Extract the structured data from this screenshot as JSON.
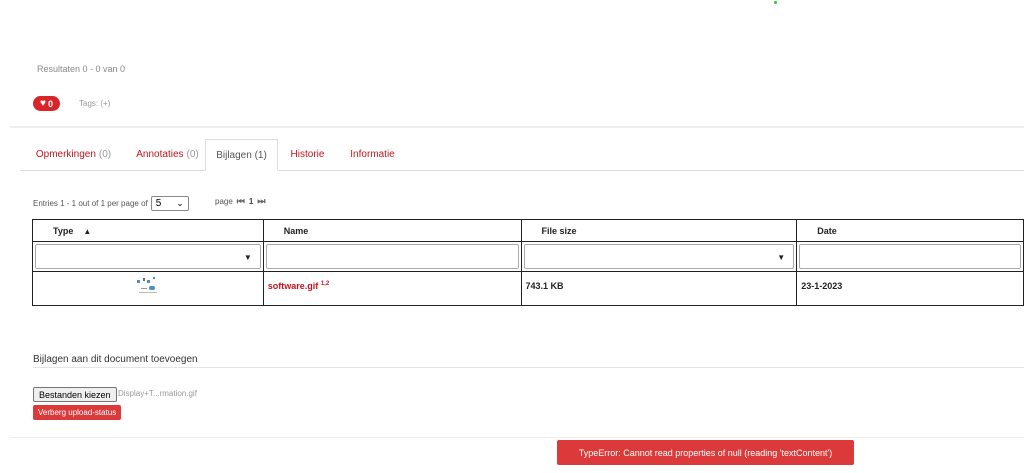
{
  "results_text": "Resultaten 0 - 0 van 0",
  "likes": {
    "count": "0",
    "icon": "heart-icon"
  },
  "tags_label": "Tags: (+)",
  "tabs": [
    {
      "label": "Opmerkingen",
      "count": "(0)"
    },
    {
      "label": "Annotaties",
      "count": "(0)"
    },
    {
      "label": "Bijlagen (1)",
      "count": ""
    },
    {
      "label": "Historie",
      "count": ""
    },
    {
      "label": "Informatie",
      "count": ""
    }
  ],
  "entries": {
    "text": "Entries 1 - 1 out of 1 per page of",
    "per_page": "5"
  },
  "pager": {
    "label": "page",
    "current": "1"
  },
  "table": {
    "headers": [
      "Type",
      "Name",
      "File size",
      "Date"
    ],
    "rows": [
      {
        "name": "software.gif",
        "sup": "1,2",
        "size": "743.1 KB",
        "date": "23-1-2023"
      }
    ]
  },
  "add_section": {
    "title": "Bijlagen aan dit document toevoegen",
    "choose_button": "Bestanden kiezen",
    "chosen_file": "Display+T...rmation.gif",
    "hide_button": "Verberg upload-status"
  },
  "error_message": "TypeError: Cannot read properties of null (reading 'textContent')",
  "colors": {
    "accent": "#c0161f",
    "error": "#dc3a3a"
  }
}
